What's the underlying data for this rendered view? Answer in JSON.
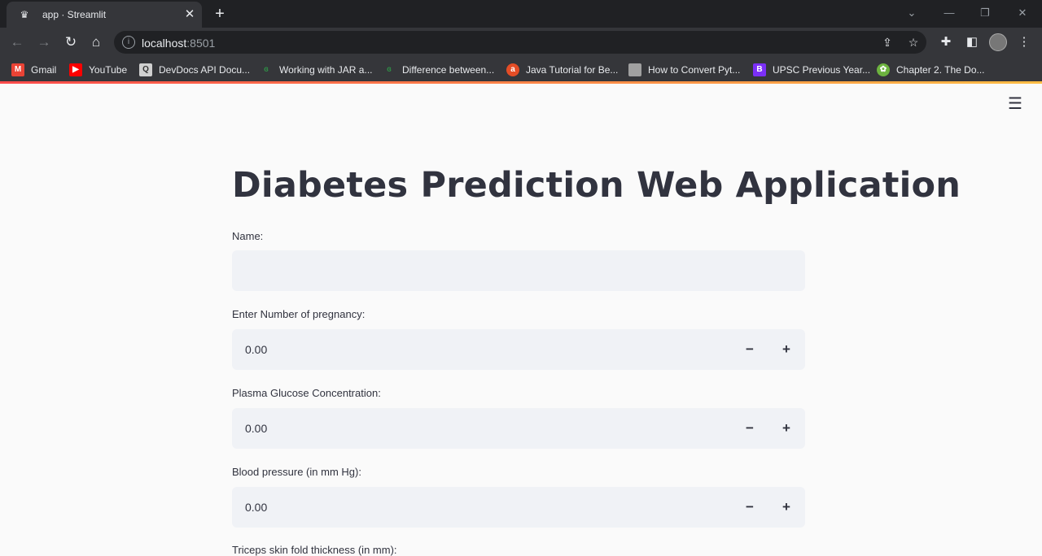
{
  "browser": {
    "tab_title": "app · Streamlit",
    "url_host": "localhost",
    "url_port": ":8501",
    "bookmarks": [
      {
        "label": "Gmail",
        "icon": "gmail-icon",
        "color": "#ea4335"
      },
      {
        "label": "YouTube",
        "icon": "youtube-icon",
        "color": "#ff0000"
      },
      {
        "label": "DevDocs API Docu...",
        "icon": "devdocs-icon",
        "color": "#d0d0d0"
      },
      {
        "label": "Working with JAR a...",
        "icon": "geeksforgeeks-icon",
        "color": "#2f8d46"
      },
      {
        "label": "Difference between...",
        "icon": "geeksforgeeks-icon",
        "color": "#2f8d46"
      },
      {
        "label": "Java Tutorial for Be...",
        "icon": "tutorial-icon",
        "color": "#e44d26"
      },
      {
        "label": "How to Convert Pyt...",
        "icon": "article-icon",
        "color": "#a0a0a0"
      },
      {
        "label": "UPSC Previous Year...",
        "icon": "upsc-icon",
        "color": "#7b2ff7"
      },
      {
        "label": "Chapter 2. The Do...",
        "icon": "spring-icon",
        "color": "#6db33f"
      }
    ]
  },
  "app": {
    "title": "Diabetes Prediction Web Application",
    "fields": [
      {
        "label": "Name:",
        "type": "text",
        "value": ""
      },
      {
        "label": "Enter Number of pregnancy:",
        "type": "number",
        "value": "0.00",
        "minus": "−",
        "plus": "+"
      },
      {
        "label": "Plasma Glucose Concentration:",
        "type": "number",
        "value": "0.00",
        "minus": "−",
        "plus": "+"
      },
      {
        "label": "Blood pressure (in mm Hg):",
        "type": "number",
        "value": "0.00",
        "minus": "−",
        "plus": "+"
      },
      {
        "label": "Triceps skin fold thickness (in mm):",
        "type": "number",
        "value": ""
      }
    ]
  },
  "colors": {
    "accent_start": "#ff4b4b",
    "accent_end": "#ffbd45",
    "text": "#31333f",
    "input_bg": "#f0f2f6"
  }
}
